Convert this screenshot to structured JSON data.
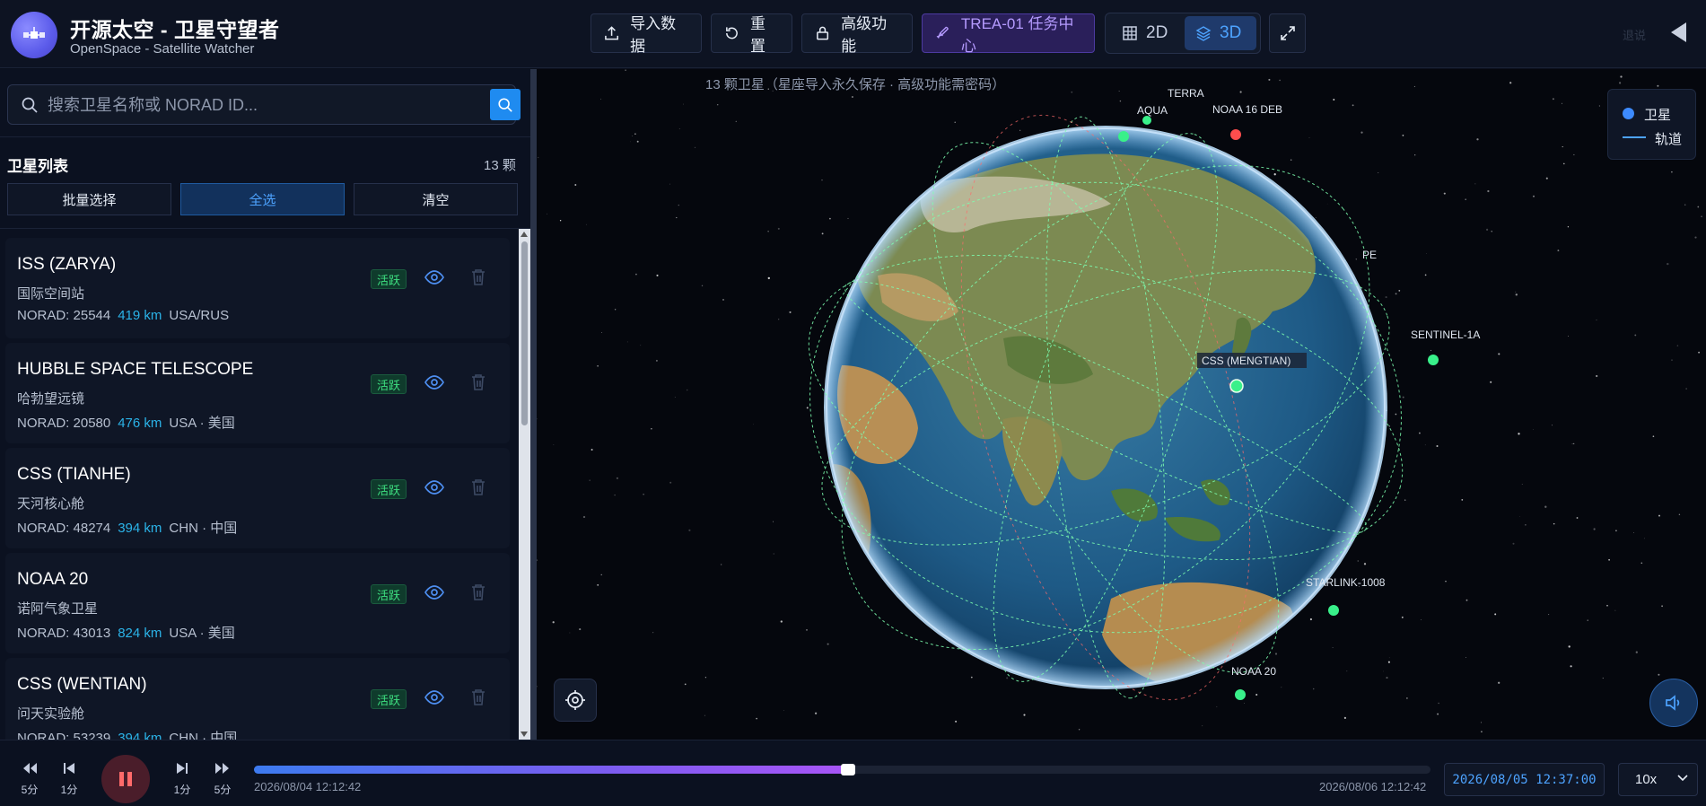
{
  "header": {
    "title": "开源太空 - 卫星守望者",
    "subtitle": "OpenSpace - Satellite Watcher",
    "import_label": "导入数据",
    "reset_label": "重置",
    "advanced_label": "高级功能",
    "mission_label": "TREA-01 任务中心",
    "view_2d_label": "2D",
    "view_3d_label": "3D",
    "active_view": "3D",
    "faint_label": "退说"
  },
  "sidebar": {
    "search": {
      "placeholder": "搜索卫星名称或 NORAD ID...",
      "value": ""
    },
    "list_title": "卫星列表",
    "count_label": "13 颗",
    "batch_select_label": "批量选择",
    "select_all_label": "全选",
    "clear_label": "清空",
    "satellites": [
      {
        "name": "ISS (ZARYA)",
        "cn_name": "国际空间站",
        "norad": "NORAD: 25544",
        "altitude": "419 km",
        "country": "USA/RUS",
        "status": "活跃"
      },
      {
        "name": "HUBBLE SPACE TELESCOPE",
        "cn_name": "哈勃望远镜",
        "norad": "NORAD: 20580",
        "altitude": "476 km",
        "country": "USA · 美国",
        "status": "活跃"
      },
      {
        "name": "CSS (TIANHE)",
        "cn_name": "天河核心舱",
        "norad": "NORAD: 48274",
        "altitude": "394 km",
        "country": "CHN · 中国",
        "status": "活跃"
      },
      {
        "name": "NOAA 20",
        "cn_name": "诺阿气象卫星",
        "norad": "NORAD: 43013",
        "altitude": "824 km",
        "country": "USA · 美国",
        "status": "活跃"
      },
      {
        "name": "CSS (WENTIAN)",
        "cn_name": "问天实验舱",
        "norad": "NORAD: 53239",
        "altitude": "394 km",
        "country": "CHN · 中国",
        "status": "活跃"
      }
    ]
  },
  "viewport": {
    "caption": "13 颗卫星（星座导入永久保存 · 高级功能需密码）",
    "legend": {
      "satellite_label": "卫星",
      "orbit_label": "轨道"
    },
    "satellite_labels": {
      "terra": "TERRA",
      "aqua": "AQUA",
      "noaa16": "NOAA 16 DEB",
      "pe": "PE",
      "sentinel": "SENTINEL-1A",
      "css": "CSS (MENGTIAN)",
      "starlink": "STARLINK-1008",
      "noaa20": "NOAA 20"
    }
  },
  "timeline": {
    "back_big_label": "5分",
    "back_small_label": "1分",
    "fwd_small_label": "1分",
    "fwd_big_label": "5分",
    "start_time": "2026/08/04 12:12:42",
    "end_time": "2026/08/06 12:12:42",
    "current_time": "2026/08/05 12:37:00",
    "progress": 0.505,
    "speed": "10x"
  },
  "colors": {
    "accent": "#4da3ff",
    "mission": "#b59bff",
    "active_status": "#3ee081",
    "orbit": "#7dffb0",
    "debris": "#ff4d4d"
  }
}
